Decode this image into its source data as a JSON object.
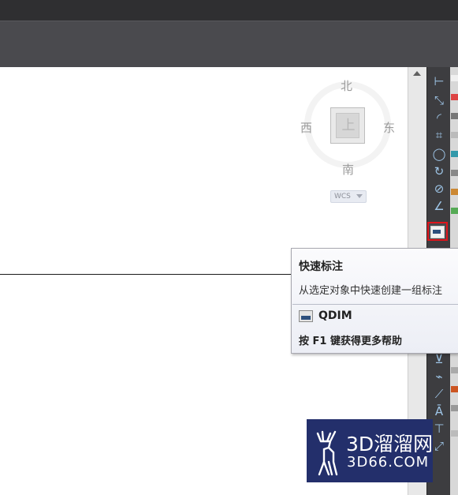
{
  "viewcube": {
    "north": "北",
    "south": "南",
    "east": "东",
    "west": "西",
    "face": "上",
    "coord_system": "WCS"
  },
  "tooltip": {
    "title": "快速标注",
    "description": "从选定对象中快速创建一组标注",
    "command": "QDIM",
    "help": "按 F1 键获得更多帮助"
  },
  "watermark": {
    "brand": "3D溜溜网",
    "domain": "3D66.COM"
  },
  "toolbar": {
    "selected_tool": "quick-dimension-icon",
    "highlight_color": "#e0151c"
  }
}
